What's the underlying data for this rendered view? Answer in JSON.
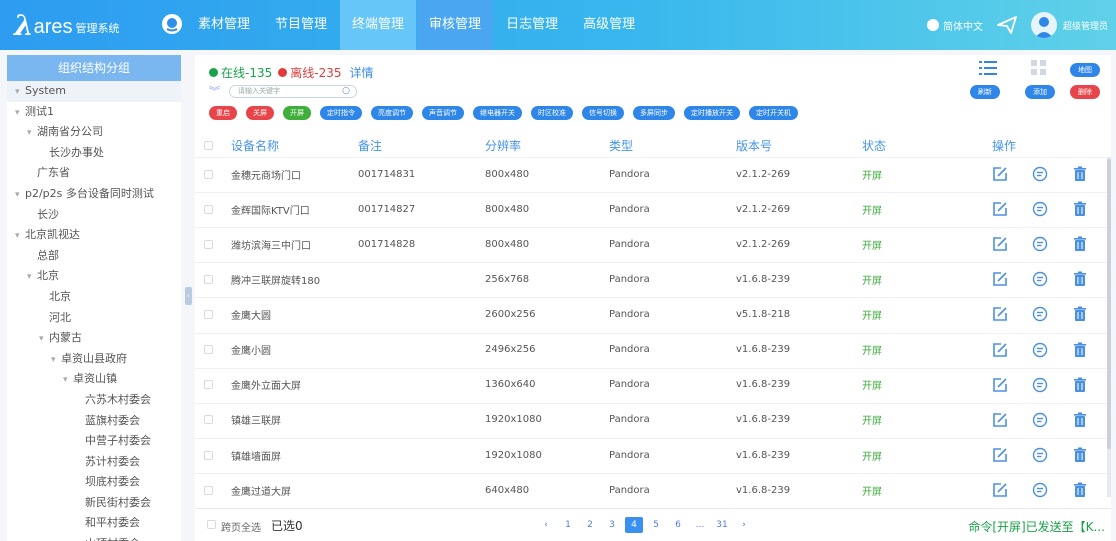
{
  "app": {
    "logo_mark": "λ",
    "logo_name": "ares",
    "logo_sub": "管理系统"
  },
  "nav": [
    "素材管理",
    "节目管理",
    "终端管理",
    "审核管理",
    "日志管理",
    "高级管理"
  ],
  "top_right": {
    "language": "简体中文",
    "user": "超级管理员"
  },
  "sidebar": {
    "title": "组织结构分组",
    "tree": [
      {
        "label": "System",
        "caret": "▾",
        "level": 0
      },
      {
        "label": "测试1",
        "caret": "▾",
        "level": 0
      },
      {
        "label": "湖南省分公司",
        "caret": "▾",
        "level": 1
      },
      {
        "label": "长沙办事处",
        "caret": "",
        "level": 2
      },
      {
        "label": "广东省",
        "caret": "",
        "level": 1
      },
      {
        "label": "p2/p2s 多台设备同时测试",
        "caret": "▾",
        "level": 0
      },
      {
        "label": "长沙",
        "caret": "",
        "level": 1
      },
      {
        "label": "北京凯视达",
        "caret": "▾",
        "level": 0
      },
      {
        "label": "总部",
        "caret": "",
        "level": 1
      },
      {
        "label": "北京",
        "caret": "▾",
        "level": 1
      },
      {
        "label": "北京",
        "caret": "",
        "level": 2
      },
      {
        "label": "河北",
        "caret": "",
        "level": 2
      },
      {
        "label": "内蒙古",
        "caret": "▾",
        "level": 2
      },
      {
        "label": "卓资山县政府",
        "caret": "▾",
        "level": 3
      },
      {
        "label": "卓资山镇",
        "caret": "▾",
        "level": 4
      },
      {
        "label": "六苏木村委会",
        "caret": "",
        "level": 5
      },
      {
        "label": "蓝旗村委会",
        "caret": "",
        "level": 5
      },
      {
        "label": "中营子村委会",
        "caret": "",
        "level": 5
      },
      {
        "label": "苏计村委会",
        "caret": "",
        "level": 5
      },
      {
        "label": "坝底村委会",
        "caret": "",
        "level": 5
      },
      {
        "label": "新民街村委会",
        "caret": "",
        "level": 5
      },
      {
        "label": "和平村委会",
        "caret": "",
        "level": 5
      },
      {
        "label": "山顶村委会",
        "caret": "",
        "level": 5
      }
    ]
  },
  "status": {
    "online": "在线-135",
    "offline": "离线-235",
    "detail": "详情"
  },
  "search": {
    "placeholder": "请输入关键字"
  },
  "action_buttons": [
    {
      "label": "重启",
      "color": "red"
    },
    {
      "label": "关屏",
      "color": "red"
    },
    {
      "label": "开屏",
      "color": "green"
    },
    {
      "label": "定时指令",
      "color": "blue"
    },
    {
      "label": "亮度调节",
      "color": "blue"
    },
    {
      "label": "声音调节",
      "color": "blue"
    },
    {
      "label": "继电器开关",
      "color": "blue"
    },
    {
      "label": "时区校准",
      "color": "blue"
    },
    {
      "label": "信号切换",
      "color": "blue"
    },
    {
      "label": "多屏同步",
      "color": "blue"
    },
    {
      "label": "定时播放开关",
      "color": "blue"
    },
    {
      "label": "定时开关机",
      "color": "blue"
    }
  ],
  "right_buttons": {
    "map": "地图",
    "refresh": "刷新",
    "add": "添加",
    "delete": "删除"
  },
  "table": {
    "headers": [
      "设备名称",
      "备注",
      "分辨率",
      "类型",
      "版本号",
      "状态",
      "操作"
    ],
    "rows": [
      {
        "name": "金穗元商场门口",
        "note": "001714831",
        "res": "800x480",
        "type": "Pandora",
        "ver": "v2.1.2-269",
        "status": "开屏"
      },
      {
        "name": "金辉国际KTV门口",
        "note": "001714827",
        "res": "800x480",
        "type": "Pandora",
        "ver": "v2.1.2-269",
        "status": "开屏"
      },
      {
        "name": "潍坊滨海三中门口",
        "note": "001714828",
        "res": "800x480",
        "type": "Pandora",
        "ver": "v2.1.2-269",
        "status": "开屏"
      },
      {
        "name": "腾冲三联屏旋转180",
        "note": "",
        "res": "256x768",
        "type": "Pandora",
        "ver": "v1.6.8-239",
        "status": "开屏"
      },
      {
        "name": "金鹰大圆",
        "note": "",
        "res": "2600x256",
        "type": "Pandora",
        "ver": "v5.1.8-218",
        "status": "开屏"
      },
      {
        "name": "金鹰小圆",
        "note": "",
        "res": "2496x256",
        "type": "Pandora",
        "ver": "v1.6.8-239",
        "status": "开屏"
      },
      {
        "name": "金鹰外立面大屏",
        "note": "",
        "res": "1360x640",
        "type": "Pandora",
        "ver": "v1.6.8-239",
        "status": "开屏"
      },
      {
        "name": "镇雄三联屏",
        "note": "",
        "res": "1920x1080",
        "type": "Pandora",
        "ver": "v1.6.8-239",
        "status": "开屏"
      },
      {
        "name": "镇雄墙面屏",
        "note": "",
        "res": "1920x1080",
        "type": "Pandora",
        "ver": "v1.6.8-239",
        "status": "开屏"
      },
      {
        "name": "金鹰过道大屏",
        "note": "",
        "res": "640x480",
        "type": "Pandora",
        "ver": "v1.6.8-239",
        "status": "开屏"
      }
    ]
  },
  "footer": {
    "select_all": "跨页全选",
    "selected": "已选0",
    "pages": [
      "‹",
      "1",
      "2",
      "3",
      "4",
      "5",
      "6",
      "…",
      "31",
      "›"
    ],
    "current_page": "4",
    "message": "命令[开屏]已发送至【K..."
  },
  "colors": {
    "primary": "#2f86e9",
    "danger": "#e8454b",
    "success": "#3fae3a",
    "header_text": "#4594e8"
  },
  "icons": {
    "edit": "edit-icon",
    "detail": "detail-icon",
    "trash": "trash-icon"
  }
}
